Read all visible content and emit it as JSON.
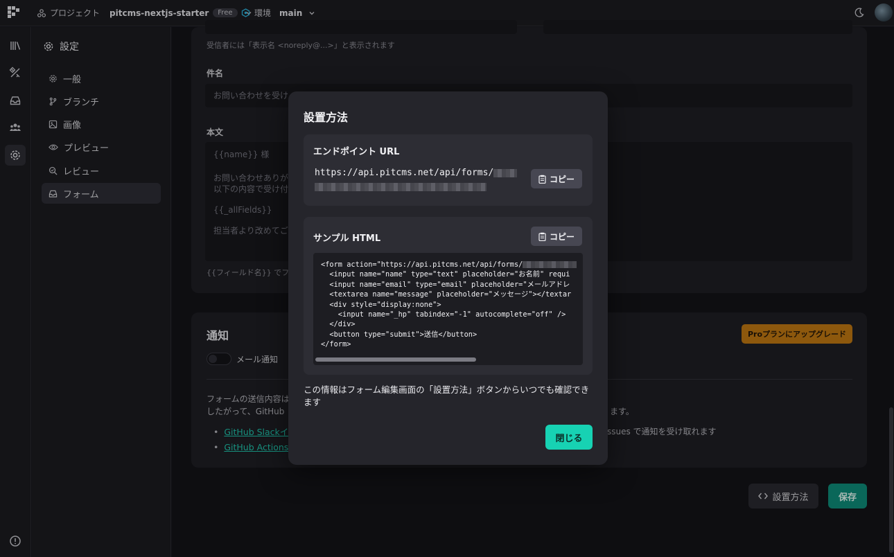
{
  "topbar": {
    "project_label": "プロジェクト",
    "project_name": "pitcms-nextjs-starter",
    "plan_badge": "Free",
    "env_label": "環境",
    "env_name": "main"
  },
  "sidebar": {
    "title": "設定",
    "items": [
      {
        "label": "一般",
        "icon": "gear-icon"
      },
      {
        "label": "ブランチ",
        "icon": "branch-icon"
      },
      {
        "label": "画像",
        "icon": "image-icon"
      },
      {
        "label": "プレビュー",
        "icon": "eye-icon"
      },
      {
        "label": "レビュー",
        "icon": "review-icon"
      },
      {
        "label": "フォーム",
        "icon": "inbox-icon"
      }
    ]
  },
  "main": {
    "sender_note": "受信者には「表示名 <noreply@...>」と表示されます",
    "subject_label": "件名",
    "subject_placeholder": "お問い合わせを受け",
    "body_label": "本文",
    "body_lines": [
      "{{name}} 様",
      "お問い合わせありが",
      "以下の内容で受け付",
      "{{_allFields}}",
      "担当者より改めてご"
    ],
    "field_hint": "{{フィールド名}} でフォー",
    "notify_title": "通知",
    "upgrade_label": "Proプランにアップグレード",
    "email_toggle_label": "メール通知",
    "notify_desc_1": "フォームの送信内容は",
    "notify_desc_2": "したがって、GitHub",
    "notify_desc_2_tail": "ます。",
    "link_slack": "GitHub Slackイ",
    "link_actions": "GitHub Actions",
    "issues_tail": "ssues で通知を受け取れます",
    "howto_button": "設置方法",
    "save_button": "保存"
  },
  "modal": {
    "title": "設置方法",
    "endpoint_title": "エンドポイント URL",
    "endpoint_url": "https://api.pitcms.net/api/forms/",
    "copy_label": "コピー",
    "sample_title": "サンプル HTML",
    "code_lines": [
      "<form action=\"https://api.pitcms.net/api/forms/",
      "  <input name=\"name\" type=\"text\" placeholder=\"お名前\" requi",
      "  <input name=\"email\" type=\"email\" placeholder=\"メールアドレ",
      "  <textarea name=\"message\" placeholder=\"メッセージ\"></textar",
      "  <div style=\"display:none\">",
      "    <input name=\"_hp\" tabindex=\"-1\" autocomplete=\"off\" />",
      "  </div>",
      "  <button type=\"submit\">送信</button>",
      "</form>"
    ],
    "info_text": "この情報はフォーム編集画面の「設置方法」ボタンからいつでも確認できます",
    "close_button": "閉じる"
  },
  "colors": {
    "accent": "#17d2b3",
    "link": "#21c9b0",
    "upgrade": "#c47a13",
    "save": "#0f8f7c"
  }
}
